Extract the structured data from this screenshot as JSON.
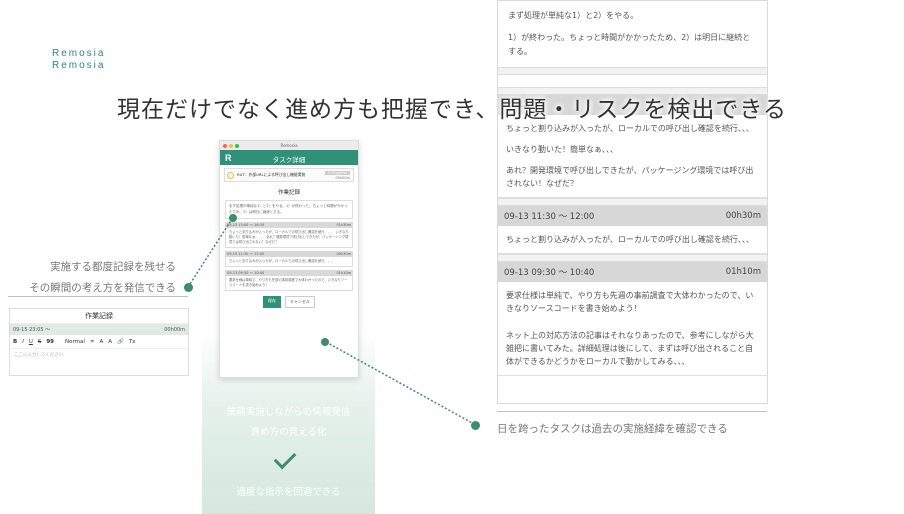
{
  "brand": {
    "line1": "Remosia",
    "line2": "Remosia"
  },
  "headline": "現在だけでなく進め方も把握でき、問題・リスクを検出できる",
  "log_panel": {
    "top_lines": [
      "まず処理が単純な1）と2）をやる。",
      "1）が終わった。ちょっと時間がかかったため、2）は明日に継続とする。"
    ],
    "entries": [
      {
        "date": "09-13",
        "duration": "",
        "lines": [
          "ちょっと割り込みが入ったが、ローカルでの呼び出し確認を続行、、、",
          "いきなり動いた！簡単なぁ、、、",
          "あれ？開発環境で呼び出しできたが、パッケージング環境では呼び出されない！なぜだ？"
        ]
      },
      {
        "date": "09-13 11:30 〜 12:00",
        "duration": "00h30m",
        "lines": [
          "ちょっと割り込みが入ったが、ローカルでの呼び出し確認を続行、、、"
        ]
      },
      {
        "date": "09-13 09:30 〜 10:40",
        "duration": "01h10m",
        "lines": [
          "要求仕様は単純で、やり方も先週の事前調査で大体わかったので、いきなりソースコードを書き始めよう！",
          "ネット上の対応方法の記事はそれなりあったので、参考にしながら大雑把に書いてみた。詳細処理は後にして、まずは呼び出されること自体ができるかどうかをローカルで動かしてみる、、、"
        ]
      }
    ]
  },
  "app_window": {
    "window_title": "Remosia",
    "logo": "R",
    "header_title": "タスク詳細",
    "task_name": "RUT：外部URLによる呼び出し機能実装",
    "task_badge": "In Progress",
    "task_duration": "05h00m",
    "section_title": "作業記録",
    "note_text": "まず処理が単純な1）と2）をやる。1）が終わった。ちょっと時間がかかったため、2）は明日に継続とする。",
    "entries": [
      {
        "date": "09-13 15:00 〜 16:30",
        "duration": "01h30m",
        "text": "ちょっと割り込みが入ったが、ローカルでの呼び出し確認を続行、、、 いきなり動いた！簡単なぁ、、、 あれ？開発環境で呼び出しできたが、パッケージング環境では呼び出されない！なぜだ？"
      },
      {
        "date": "09-13 11:30 〜 12:00",
        "duration": "00h30m",
        "text": "ちょっと割り込みが入ったが、ローカルでの呼び出し確認を続行、、、"
      },
      {
        "date": "09-13 09:30 〜 10:40",
        "duration": "01h10m",
        "text": "要求仕様は単純で、やり方も先週の事前調査で大体わかったので、いきなりソースコードを書き始めよう！"
      }
    ],
    "save_label": "保存",
    "cancel_label": "キャンセル"
  },
  "feature_card": {
    "line1": "業務実施しながらの情報発信",
    "line2": "進め方の見える化",
    "line3": "過度な指示を回避できる"
  },
  "captions": {
    "left_line1": "実施する都度記録を残せる",
    "left_line2": "その瞬間の考え方を発信できる",
    "right": "日を跨ったタスクは過去の実施経緯を確認できる"
  },
  "editor": {
    "title": "作業記録",
    "date": "09-15 23:05 〜",
    "duration": "00h00m",
    "toolbar": [
      "B",
      "I",
      "U",
      "S",
      "99",
      "Normal",
      "≑",
      "A",
      "A",
      "🔗",
      "Tx"
    ],
    "placeholder": "ここに入力してください"
  },
  "colors": {
    "accent": "#2f9178",
    "bullet": "#3b8e6d",
    "entry_header": "#d7d7d7"
  }
}
